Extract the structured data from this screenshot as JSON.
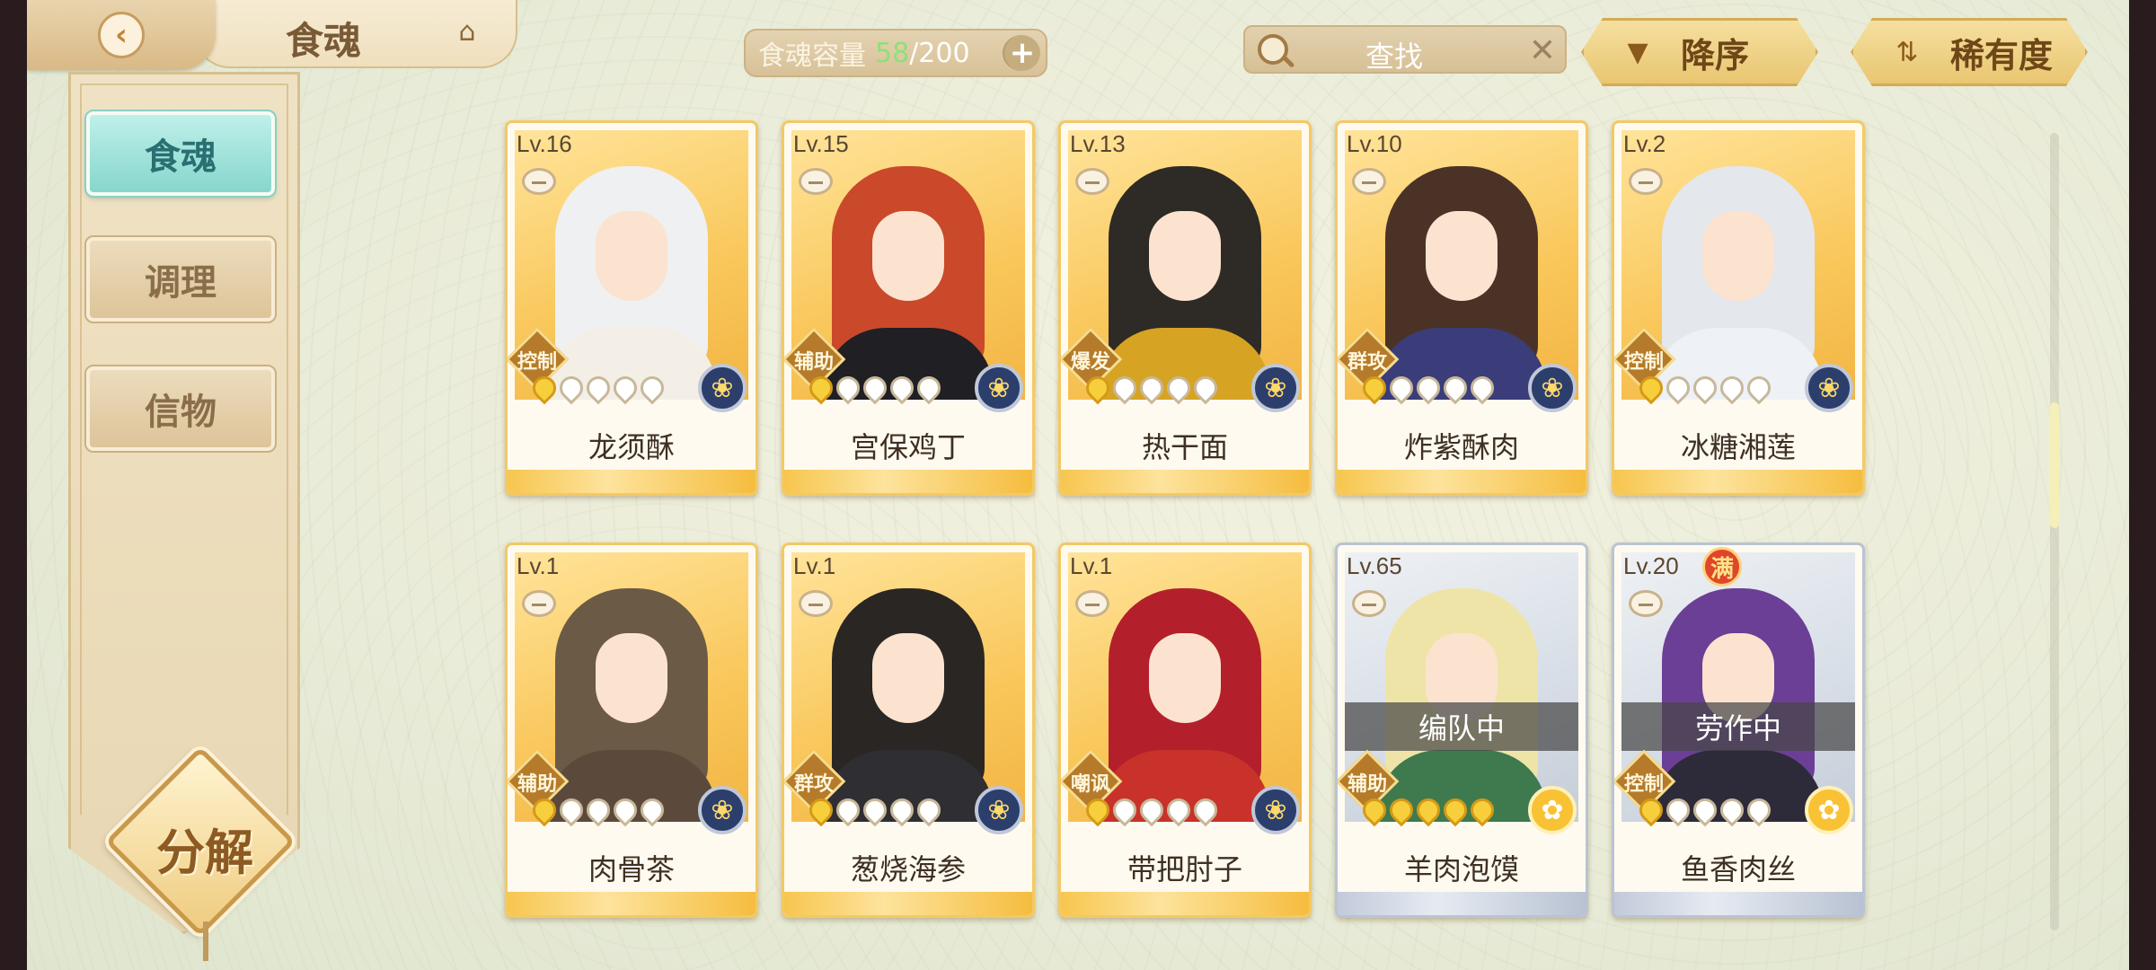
{
  "header": {
    "title": "食魂",
    "capacity_label": "食魂容量",
    "capacity_current": "58",
    "capacity_max": "/200",
    "search_label": "查找",
    "sort_desc_label": "降序",
    "sort_rarity_label": "稀有度"
  },
  "sidebar": {
    "tabs": [
      {
        "label": "食魂"
      },
      {
        "label": "调理"
      },
      {
        "label": "信物"
      }
    ],
    "decompose_label": "分解"
  },
  "cards": [
    {
      "level": "Lv.16",
      "name": "龙须酥",
      "role": "控制",
      "stars": 1,
      "element": "blue",
      "frame": "gold"
    },
    {
      "level": "Lv.15",
      "name": "宫保鸡丁",
      "role": "辅助",
      "stars": 1,
      "element": "blue",
      "frame": "gold"
    },
    {
      "level": "Lv.13",
      "name": "热干面",
      "role": "爆发",
      "stars": 1,
      "element": "blue",
      "frame": "gold"
    },
    {
      "level": "Lv.10",
      "name": "炸紫酥肉",
      "role": "群攻",
      "stars": 1,
      "element": "blue",
      "frame": "gold"
    },
    {
      "level": "Lv.2",
      "name": "冰糖湘莲",
      "role": "控制",
      "stars": 1,
      "element": "blue",
      "frame": "gold"
    },
    {
      "level": "Lv.1",
      "name": "肉骨茶",
      "role": "辅助",
      "stars": 1,
      "element": "blue",
      "frame": "gold"
    },
    {
      "level": "Lv.1",
      "name": "葱烧海参",
      "role": "群攻",
      "stars": 1,
      "element": "blue",
      "frame": "gold"
    },
    {
      "level": "Lv.1",
      "name": "带把肘子",
      "role": "嘲讽",
      "stars": 1,
      "element": "blue",
      "frame": "gold"
    },
    {
      "level": "Lv.65",
      "name": "羊肉泡馍",
      "role": "辅助",
      "stars": 5,
      "element": "gold",
      "frame": "silver",
      "status": "编队中"
    },
    {
      "level": "Lv.20",
      "name": "鱼香肉丝",
      "role": "控制",
      "stars": 1,
      "element": "gold",
      "frame": "silver",
      "status": "劳作中",
      "max_badge": "满"
    }
  ],
  "colors": {
    "accent_gold": "#f3c964",
    "active_tab": "#86d6cc",
    "capacity_current": "#8fe07a"
  }
}
